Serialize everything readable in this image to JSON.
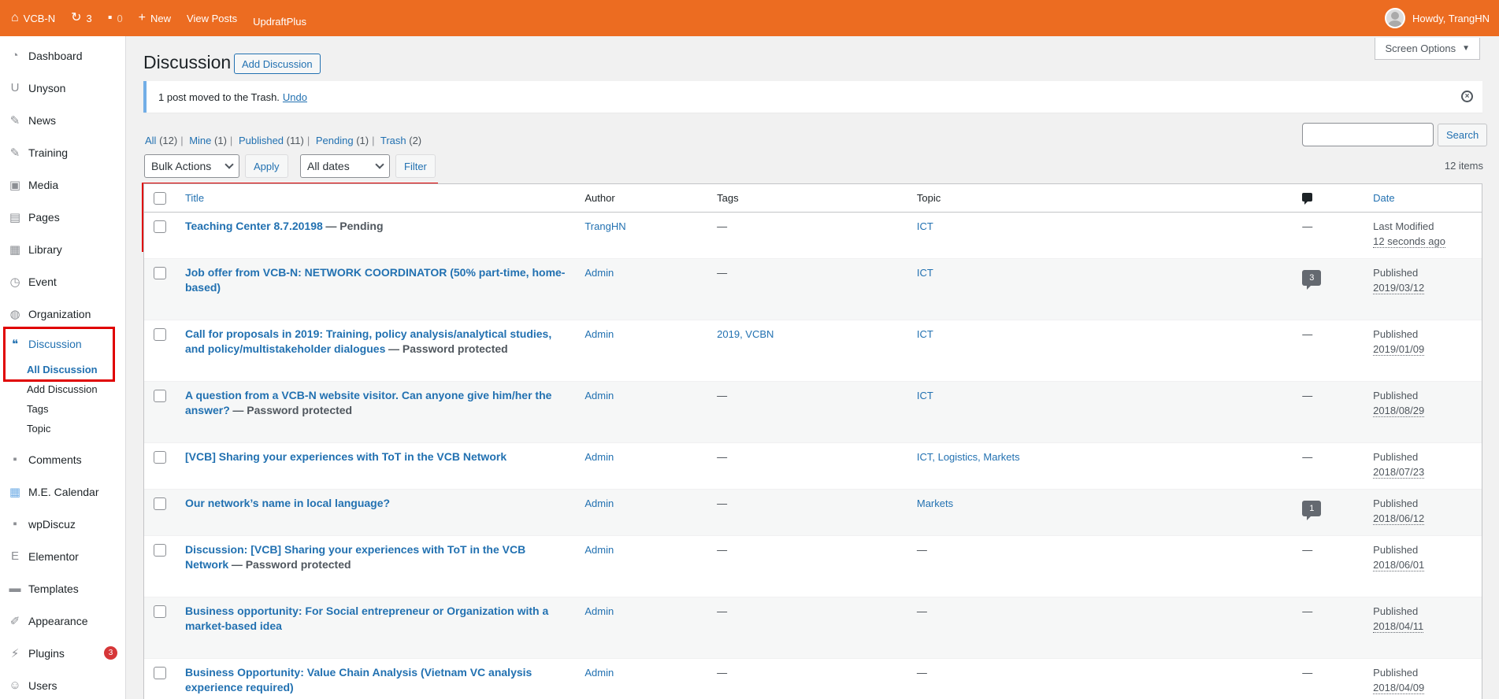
{
  "admin_bar": {
    "site_name": "VCB-N",
    "updates_count": "3",
    "comments_count": "0",
    "new_label": "New",
    "view_posts": "View Posts",
    "updraft": "UpdraftPlus",
    "howdy": "Howdy, TrangHN"
  },
  "sidebar": {
    "items": [
      {
        "label": "Dashboard",
        "icon": "dashboard-icon"
      },
      {
        "label": "Unyson",
        "icon": "unyson-icon"
      },
      {
        "label": "News",
        "icon": "pin-icon"
      },
      {
        "label": "Training",
        "icon": "pin-icon"
      },
      {
        "label": "Media",
        "icon": "media-icon"
      },
      {
        "label": "Pages",
        "icon": "pages-icon"
      },
      {
        "label": "Library",
        "icon": "library-icon"
      },
      {
        "label": "Event",
        "icon": "clock-icon"
      },
      {
        "label": "Organization",
        "icon": "globe-icon"
      },
      {
        "label": "Discussion",
        "icon": "discussion-icon"
      },
      {
        "label": "Comments",
        "icon": "comment-icon"
      },
      {
        "label": "M.E. Calendar",
        "icon": "calendar-icon"
      },
      {
        "label": "wpDiscuz",
        "icon": "wpdiscuz-icon"
      },
      {
        "label": "Elementor",
        "icon": "elementor-icon"
      },
      {
        "label": "Templates",
        "icon": "folder-icon"
      },
      {
        "label": "Appearance",
        "icon": "brush-icon"
      },
      {
        "label": "Plugins",
        "icon": "plug-icon"
      },
      {
        "label": "Users",
        "icon": "user-icon"
      }
    ],
    "discussion_sub": [
      "All Discussion",
      "Add Discussion",
      "Tags",
      "Topic"
    ],
    "plugins_badge": "3"
  },
  "header": {
    "title": "Discussion",
    "add_button": "Add Discussion",
    "screen_options": "Screen Options"
  },
  "notice": {
    "text": "1 post moved to the Trash.",
    "undo": "Undo"
  },
  "filters": {
    "all": "All",
    "all_count": "(12)",
    "mine": "Mine",
    "mine_count": "(1)",
    "published": "Published",
    "published_count": "(11)",
    "pending": "Pending",
    "pending_count": "(1)",
    "trash": "Trash",
    "trash_count": "(2)",
    "bulk_actions": "Bulk Actions",
    "apply": "Apply",
    "all_dates": "All dates",
    "filter": "Filter",
    "search": "Search",
    "items_count": "12 items"
  },
  "table": {
    "columns": {
      "title": "Title",
      "author": "Author",
      "tags": "Tags",
      "topic": "Topic",
      "date": "Date"
    },
    "rows": [
      {
        "title": "Teaching Center 8.7.20198",
        "state": "— Pending",
        "author": "TrangHN",
        "tags": "—",
        "topic": "ICT",
        "comments": "—",
        "date_status": "Last Modified",
        "date": "12 seconds ago"
      },
      {
        "title": "Job offer from VCB-N: NETWORK COORDINATOR (50% part-time, home-based)",
        "state": "",
        "author": "Admin",
        "tags": "—",
        "topic": "ICT",
        "comments": "3",
        "date_status": "Published",
        "date": "2019/03/12"
      },
      {
        "title": "Call for proposals in 2019: Training, policy analysis/analytical studies, and policy/multistakeholder dialogues",
        "state": "— Password protected",
        "author": "Admin",
        "tags": "2019, VCBN",
        "topic": "ICT",
        "comments": "—",
        "date_status": "Published",
        "date": "2019/01/09"
      },
      {
        "title": "A question from a VCB-N website visitor. Can anyone give him/her the answer?",
        "state": "— Password protected",
        "author": "Admin",
        "tags": "—",
        "topic": "ICT",
        "comments": "—",
        "date_status": "Published",
        "date": "2018/08/29"
      },
      {
        "title": "[VCB] Sharing your experiences with ToT in the VCB Network",
        "state": "",
        "author": "Admin",
        "tags": "—",
        "topic": "ICT, Logistics, Markets",
        "comments": "—",
        "date_status": "Published",
        "date": "2018/07/23"
      },
      {
        "title": "Our network’s name in local language?",
        "state": "",
        "author": "Admin",
        "tags": "—",
        "topic": "Markets",
        "comments": "1",
        "date_status": "Published",
        "date": "2018/06/12"
      },
      {
        "title": "Discussion: [VCB] Sharing your experiences with ToT in the VCB Network",
        "state": "— Password protected",
        "author": "Admin",
        "tags": "—",
        "topic": "—",
        "comments": "—",
        "date_status": "Published",
        "date": "2018/06/01"
      },
      {
        "title": "Business opportunity: For Social entrepreneur or Organization with a market-based idea",
        "state": "",
        "author": "Admin",
        "tags": "—",
        "topic": "—",
        "comments": "—",
        "date_status": "Published",
        "date": "2018/04/11"
      },
      {
        "title": "Business Opportunity: Value Chain Analysis (Vietnam VC analysis experience required)",
        "state": "",
        "author": "Admin",
        "tags": "—",
        "topic": "—",
        "comments": "—",
        "date_status": "Published",
        "date": "2018/04/09"
      }
    ]
  }
}
